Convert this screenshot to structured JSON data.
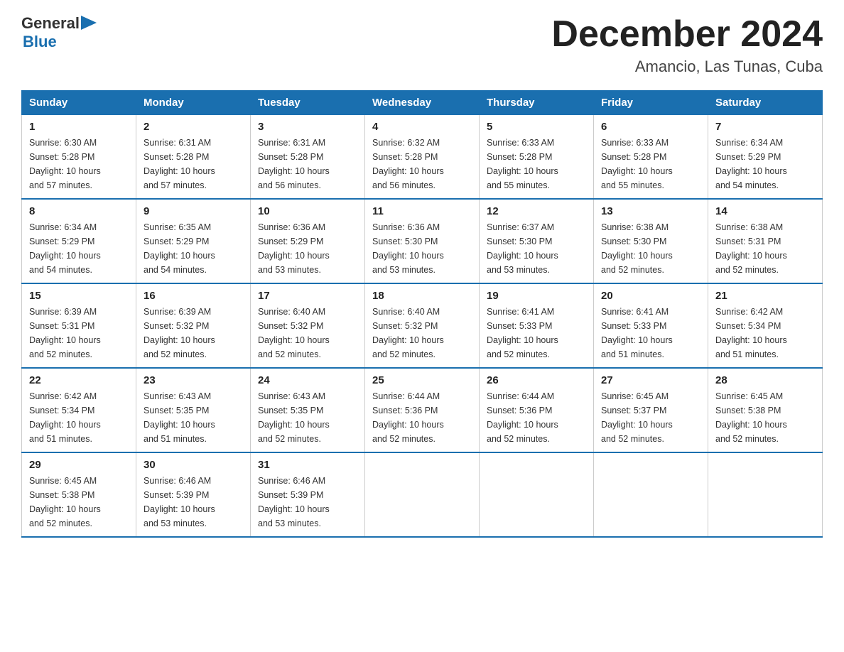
{
  "logo": {
    "text_general": "General",
    "text_blue": "Blue",
    "arrow": "▶"
  },
  "header": {
    "title": "December 2024",
    "subtitle": "Amancio, Las Tunas, Cuba"
  },
  "weekdays": [
    "Sunday",
    "Monday",
    "Tuesday",
    "Wednesday",
    "Thursday",
    "Friday",
    "Saturday"
  ],
  "weeks": [
    [
      {
        "day": "1",
        "sunrise": "6:30 AM",
        "sunset": "5:28 PM",
        "daylight": "10 hours and 57 minutes."
      },
      {
        "day": "2",
        "sunrise": "6:31 AM",
        "sunset": "5:28 PM",
        "daylight": "10 hours and 57 minutes."
      },
      {
        "day": "3",
        "sunrise": "6:31 AM",
        "sunset": "5:28 PM",
        "daylight": "10 hours and 56 minutes."
      },
      {
        "day": "4",
        "sunrise": "6:32 AM",
        "sunset": "5:28 PM",
        "daylight": "10 hours and 56 minutes."
      },
      {
        "day": "5",
        "sunrise": "6:33 AM",
        "sunset": "5:28 PM",
        "daylight": "10 hours and 55 minutes."
      },
      {
        "day": "6",
        "sunrise": "6:33 AM",
        "sunset": "5:28 PM",
        "daylight": "10 hours and 55 minutes."
      },
      {
        "day": "7",
        "sunrise": "6:34 AM",
        "sunset": "5:29 PM",
        "daylight": "10 hours and 54 minutes."
      }
    ],
    [
      {
        "day": "8",
        "sunrise": "6:34 AM",
        "sunset": "5:29 PM",
        "daylight": "10 hours and 54 minutes."
      },
      {
        "day": "9",
        "sunrise": "6:35 AM",
        "sunset": "5:29 PM",
        "daylight": "10 hours and 54 minutes."
      },
      {
        "day": "10",
        "sunrise": "6:36 AM",
        "sunset": "5:29 PM",
        "daylight": "10 hours and 53 minutes."
      },
      {
        "day": "11",
        "sunrise": "6:36 AM",
        "sunset": "5:30 PM",
        "daylight": "10 hours and 53 minutes."
      },
      {
        "day": "12",
        "sunrise": "6:37 AM",
        "sunset": "5:30 PM",
        "daylight": "10 hours and 53 minutes."
      },
      {
        "day": "13",
        "sunrise": "6:38 AM",
        "sunset": "5:30 PM",
        "daylight": "10 hours and 52 minutes."
      },
      {
        "day": "14",
        "sunrise": "6:38 AM",
        "sunset": "5:31 PM",
        "daylight": "10 hours and 52 minutes."
      }
    ],
    [
      {
        "day": "15",
        "sunrise": "6:39 AM",
        "sunset": "5:31 PM",
        "daylight": "10 hours and 52 minutes."
      },
      {
        "day": "16",
        "sunrise": "6:39 AM",
        "sunset": "5:32 PM",
        "daylight": "10 hours and 52 minutes."
      },
      {
        "day": "17",
        "sunrise": "6:40 AM",
        "sunset": "5:32 PM",
        "daylight": "10 hours and 52 minutes."
      },
      {
        "day": "18",
        "sunrise": "6:40 AM",
        "sunset": "5:32 PM",
        "daylight": "10 hours and 52 minutes."
      },
      {
        "day": "19",
        "sunrise": "6:41 AM",
        "sunset": "5:33 PM",
        "daylight": "10 hours and 52 minutes."
      },
      {
        "day": "20",
        "sunrise": "6:41 AM",
        "sunset": "5:33 PM",
        "daylight": "10 hours and 51 minutes."
      },
      {
        "day": "21",
        "sunrise": "6:42 AM",
        "sunset": "5:34 PM",
        "daylight": "10 hours and 51 minutes."
      }
    ],
    [
      {
        "day": "22",
        "sunrise": "6:42 AM",
        "sunset": "5:34 PM",
        "daylight": "10 hours and 51 minutes."
      },
      {
        "day": "23",
        "sunrise": "6:43 AM",
        "sunset": "5:35 PM",
        "daylight": "10 hours and 51 minutes."
      },
      {
        "day": "24",
        "sunrise": "6:43 AM",
        "sunset": "5:35 PM",
        "daylight": "10 hours and 52 minutes."
      },
      {
        "day": "25",
        "sunrise": "6:44 AM",
        "sunset": "5:36 PM",
        "daylight": "10 hours and 52 minutes."
      },
      {
        "day": "26",
        "sunrise": "6:44 AM",
        "sunset": "5:36 PM",
        "daylight": "10 hours and 52 minutes."
      },
      {
        "day": "27",
        "sunrise": "6:45 AM",
        "sunset": "5:37 PM",
        "daylight": "10 hours and 52 minutes."
      },
      {
        "day": "28",
        "sunrise": "6:45 AM",
        "sunset": "5:38 PM",
        "daylight": "10 hours and 52 minutes."
      }
    ],
    [
      {
        "day": "29",
        "sunrise": "6:45 AM",
        "sunset": "5:38 PM",
        "daylight": "10 hours and 52 minutes."
      },
      {
        "day": "30",
        "sunrise": "6:46 AM",
        "sunset": "5:39 PM",
        "daylight": "10 hours and 53 minutes."
      },
      {
        "day": "31",
        "sunrise": "6:46 AM",
        "sunset": "5:39 PM",
        "daylight": "10 hours and 53 minutes."
      },
      null,
      null,
      null,
      null
    ]
  ],
  "labels": {
    "sunrise": "Sunrise:",
    "sunset": "Sunset:",
    "daylight": "Daylight:"
  }
}
